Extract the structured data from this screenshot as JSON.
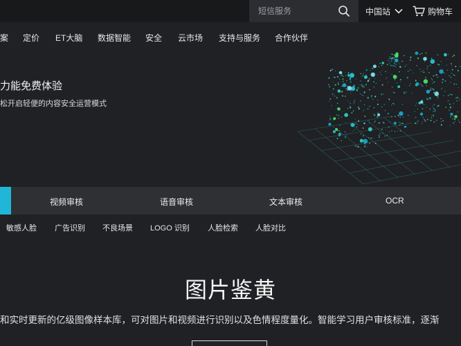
{
  "topbar": {
    "search_placeholder": "短信服务",
    "region_label": "中国站",
    "cart_label": "购物车"
  },
  "nav": {
    "items": [
      "案",
      "定价",
      "ET大脑",
      "数据智能",
      "安全",
      "云市场",
      "支持与服务",
      "合作伙伴"
    ]
  },
  "hero": {
    "title": "力能免费体验",
    "subtitle": "松开启轻便的内容安全运营模式"
  },
  "tabs": {
    "items": [
      "视频审核",
      "语音审核",
      "文本审核",
      "OCR"
    ]
  },
  "subtabs": {
    "items": [
      "敏感人脸",
      "广告识别",
      "不良场景",
      "LOGO 识别",
      "人脸检索",
      "人脸对比"
    ]
  },
  "section": {
    "title": "图片鉴黄",
    "description": "和实时更新的亿级图像样本库，可对图片和视频进行识别以及色情程度量化。智能学习用户审核标准，逐渐"
  },
  "colors": {
    "accent": "#1fb6d8",
    "background": "#1f2124",
    "tabbar": "#2e3034"
  }
}
